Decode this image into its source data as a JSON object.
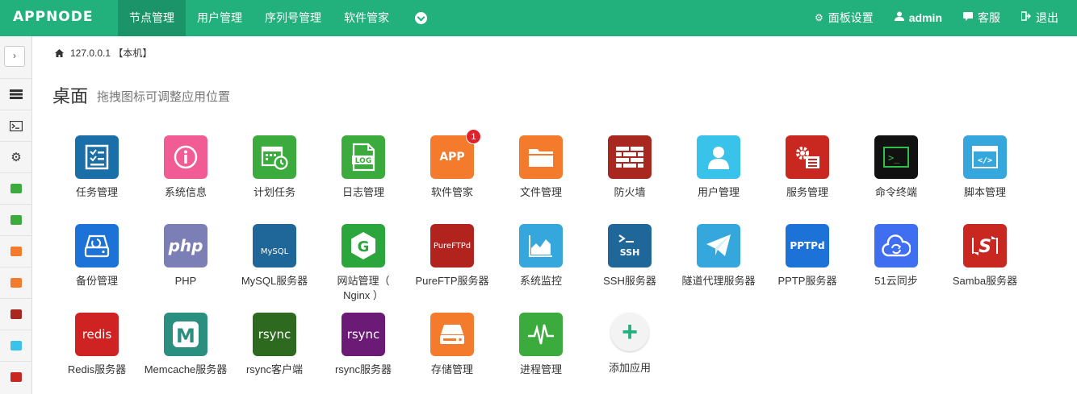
{
  "brand": "APPNODE",
  "nav": [
    {
      "label": "节点管理",
      "active": true
    },
    {
      "label": "用户管理"
    },
    {
      "label": "序列号管理"
    },
    {
      "label": "软件管家"
    }
  ],
  "right_nav": [
    {
      "label": "面板设置",
      "icon": "gear-icon"
    },
    {
      "label": "admin",
      "icon": "user-icon"
    },
    {
      "label": "客服",
      "icon": "chat-icon"
    },
    {
      "label": "退出",
      "icon": "logout-icon"
    }
  ],
  "breadcrumb": "127.0.0.1 【本机】",
  "title": "桌面",
  "subtitle": "拖拽图标可调整应用位置",
  "apps": [
    {
      "label": "任务管理",
      "color": "#1b6fa8"
    },
    {
      "label": "系统信息",
      "color": "#f25c94"
    },
    {
      "label": "计划任务",
      "color": "#3aab3c"
    },
    {
      "label": "日志管理",
      "color": "#3aab3c",
      "tile_text": "LOG"
    },
    {
      "label": "软件管家",
      "color": "#f47a2c",
      "tile_text": "APP",
      "badge": "1"
    },
    {
      "label": "文件管理",
      "color": "#f47a2c"
    },
    {
      "label": "防火墙",
      "color": "#a8281f"
    },
    {
      "label": "用户管理",
      "color": "#39c3ea"
    },
    {
      "label": "服务管理",
      "color": "#c8281f"
    },
    {
      "label": "命令终端",
      "color": "#111111",
      "tile_text": ">_"
    },
    {
      "label": "脚本管理",
      "color": "#35a7dc",
      "tile_text": "</>"
    },
    {
      "label": "备份管理",
      "color": "#1d72d8"
    },
    {
      "label": "PHP",
      "color": "#7b7fb5",
      "tile_text": "php"
    },
    {
      "label": "MySQL服务器",
      "color": "#1f6798",
      "tile_text": "MySQL"
    },
    {
      "label": "网站管理（ Nginx ）",
      "color": "#2aa63d",
      "tile_text": "G"
    },
    {
      "label": "PureFTP服务器",
      "color": "#b3231e",
      "tile_text": "PureFTPd"
    },
    {
      "label": "系统监控",
      "color": "#35a7dc"
    },
    {
      "label": "SSH服务器",
      "color": "#1f6798",
      "tile_text": "SSH"
    },
    {
      "label": "隧道代理服务器",
      "color": "#35a7dc"
    },
    {
      "label": "PPTP服务器",
      "color": "#1d72d8",
      "tile_text": "PPTPd"
    },
    {
      "label": "51云同步",
      "color": "#3f6ff0"
    },
    {
      "label": "Samba服务器",
      "color": "#c8281f",
      "tile_text": "S"
    },
    {
      "label": "Redis服务器",
      "color": "#cf2323",
      "tile_text": "redis"
    },
    {
      "label": "Memcache服务器",
      "color": "#2b8f80",
      "tile_text": "M"
    },
    {
      "label": "rsync客户端",
      "color": "#2d6a1f",
      "tile_text": "rsync"
    },
    {
      "label": "rsync服务器",
      "color": "#6b1a75",
      "tile_text": "rsync"
    },
    {
      "label": "存储管理",
      "color": "#f47a2c"
    },
    {
      "label": "进程管理",
      "color": "#3aab3c"
    },
    {
      "label": "添加应用",
      "color": "#f3f3f3",
      "tile_text": "+"
    }
  ]
}
